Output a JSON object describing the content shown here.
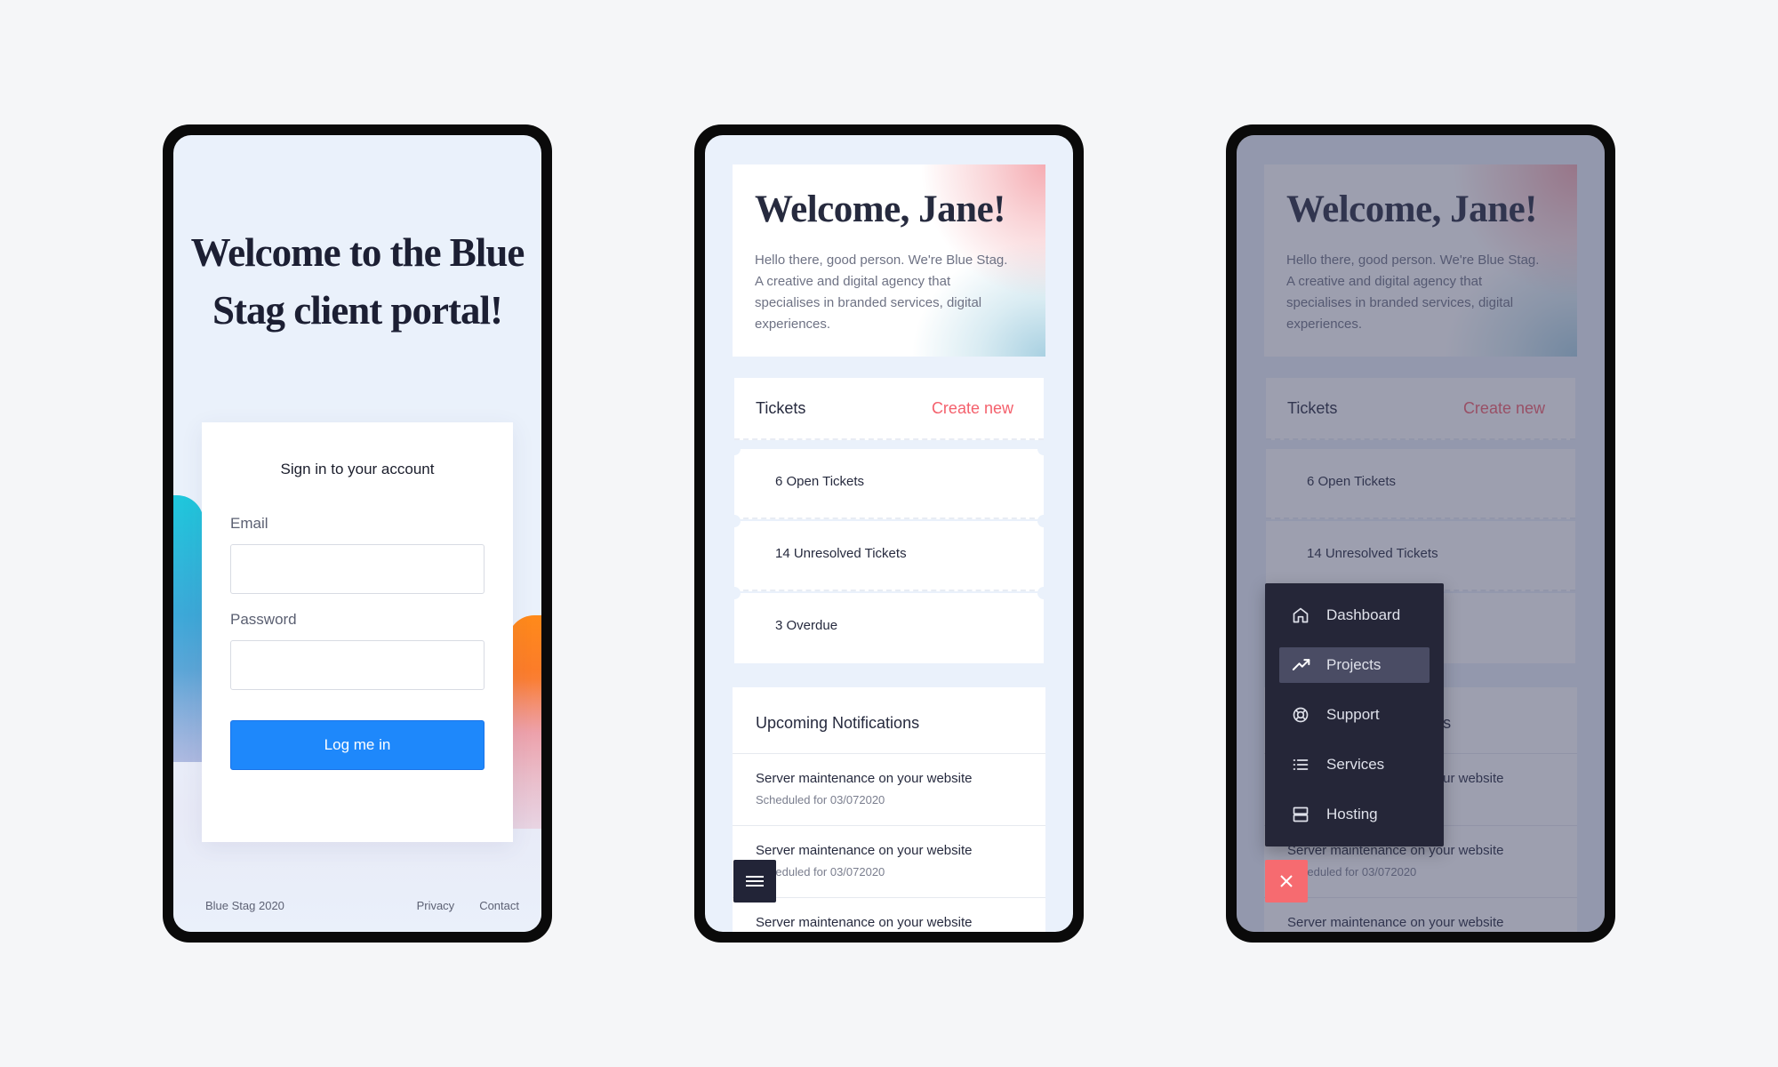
{
  "login": {
    "title": "Welcome to the Blue Stag client portal!",
    "card_title": "Sign in to your account",
    "email_label": "Email",
    "email_value": "",
    "password_label": "Password",
    "password_value": "",
    "button_label": "Log me in",
    "footer": {
      "brand": "Blue Stag 2020",
      "privacy": "Privacy",
      "contact": "Contact"
    }
  },
  "dashboard": {
    "welcome_title": "Welcome, Jane!",
    "welcome_text": "Hello there, good person. We're Blue Stag. A creative and digital agency that specialises in branded services, digital experiences.",
    "tickets": {
      "title": "Tickets",
      "create_label": "Create new",
      "items": [
        "6 Open Tickets",
        "14 Unresolved Tickets",
        "3 Overdue"
      ]
    },
    "notifications": {
      "title": "Upcoming Notifications",
      "items": [
        {
          "title": "Server maintenance on your website",
          "subtitle": "Scheduled for 03/072020"
        },
        {
          "title": "Server maintenance on your website",
          "subtitle": "Scheduled for 03/072020"
        },
        {
          "title": "Server maintenance on your website",
          "subtitle": ""
        }
      ]
    },
    "menu_toggle_icon": "hamburger-icon"
  },
  "menu": {
    "items": [
      {
        "label": "Dashboard",
        "icon": "home-icon",
        "active": false
      },
      {
        "label": "Projects",
        "icon": "trending-up-icon",
        "active": true
      },
      {
        "label": "Support",
        "icon": "lifebuoy-icon",
        "active": false
      },
      {
        "label": "Services",
        "icon": "list-icon",
        "active": false
      },
      {
        "label": "Hosting",
        "icon": "server-icon",
        "active": false
      }
    ],
    "close_icon": "close-icon"
  },
  "colors": {
    "primary_blue": "#1e88fb",
    "accent_coral": "#f4606c",
    "close_button": "#f66b70",
    "nav_background": "#252638",
    "nav_active": "#4a4c64",
    "text_dark": "#262a3e"
  }
}
